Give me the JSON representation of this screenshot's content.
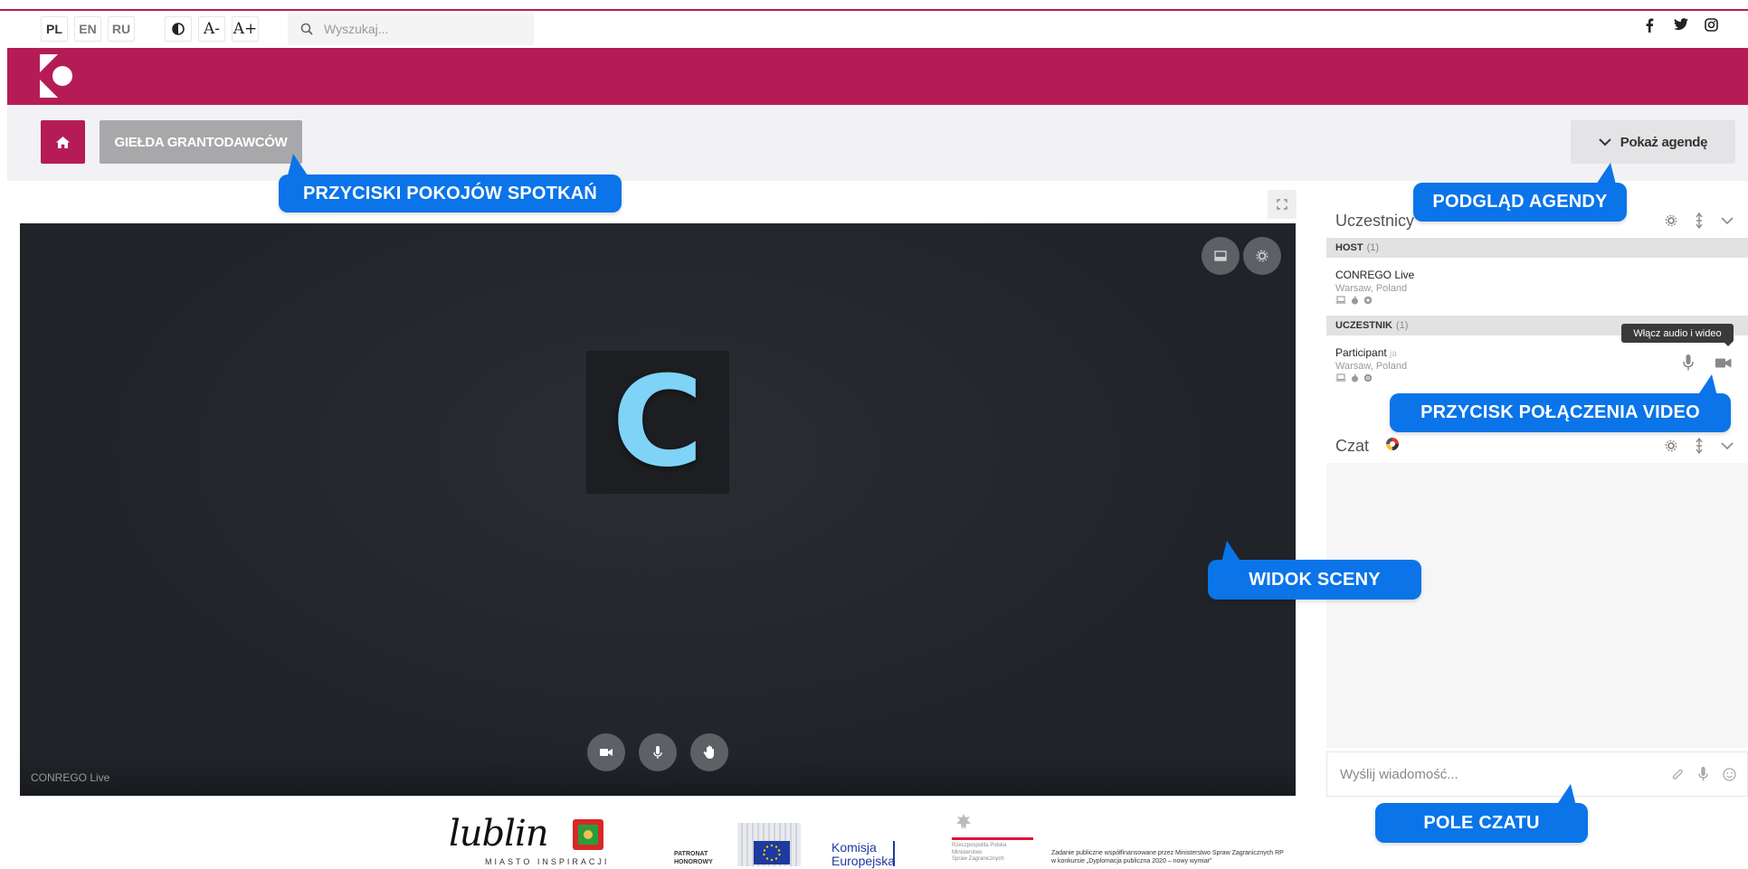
{
  "topbar": {
    "languages": [
      "PL",
      "EN",
      "RU"
    ],
    "contrast_icon": "contrast-icon",
    "font_decrease_label": "A-",
    "font_increase_label": "A+",
    "search": {
      "placeholder": "Wyszukaj...",
      "value": ""
    },
    "social_icons": [
      "facebook-icon",
      "twitter-icon",
      "instagram-icon"
    ]
  },
  "brand": {
    "logo": "conrego-logo",
    "color": "#b51c56"
  },
  "nav": {
    "home_icon": "home-icon",
    "room_button_label": "GIEŁDA GRANTODAWCÓW",
    "agenda_button_label": "Pokaż agendę"
  },
  "stage": {
    "avatar_letter": "C",
    "speaker_name": "CONREGO Live",
    "controls": [
      "camera-icon",
      "microphone-icon",
      "raise-hand-icon"
    ],
    "top_controls": [
      "layout-icon",
      "settings-icon"
    ]
  },
  "participants": {
    "title": "Uczestnicy",
    "groups": [
      {
        "label": "HOST",
        "count": "(1)",
        "members": [
          {
            "name": "CONREGO Live",
            "location": "Warsaw, Poland",
            "suffix": ""
          }
        ]
      },
      {
        "label": "UCZESTNIK",
        "count": "(1)",
        "members": [
          {
            "name": "Participant",
            "location": "Warsaw, Poland",
            "suffix": "ja"
          }
        ]
      }
    ],
    "tooltip": "Włącz audio i wideo"
  },
  "chat": {
    "title": "Czat",
    "input_placeholder": "Wyślij wiadomość...",
    "input_value": ""
  },
  "callouts": {
    "rooms": "PRZYCISKI POKOJÓW SPOTKAŃ",
    "agenda": "PODGLĄD AGENDY",
    "video": "PRZYCISK POŁĄCZENIA VIDEO",
    "scene": "WIDOK SCENY",
    "chat": "POLE CZATU"
  },
  "footer": {
    "lublin_name": "lublin",
    "lublin_tagline": "MIASTO INSPIRACJI",
    "patron_label_1": "PATRONAT",
    "patron_label_2": "HONOROWY",
    "eu_label_1": "Komisja",
    "eu_label_2": "Europejska",
    "gov_label_1": "Rzeczpospolita Polska",
    "gov_label_2": "Ministerstwo",
    "gov_label_3": "Spraw Zagranicznych",
    "funding_line_1": "Zadanie publiczne współfinansowane przez Ministerstwo Spraw Zagranicznych RP",
    "funding_line_2": "w konkursie „Dyplomacja publiczna 2020 – nowy wymiar”"
  }
}
